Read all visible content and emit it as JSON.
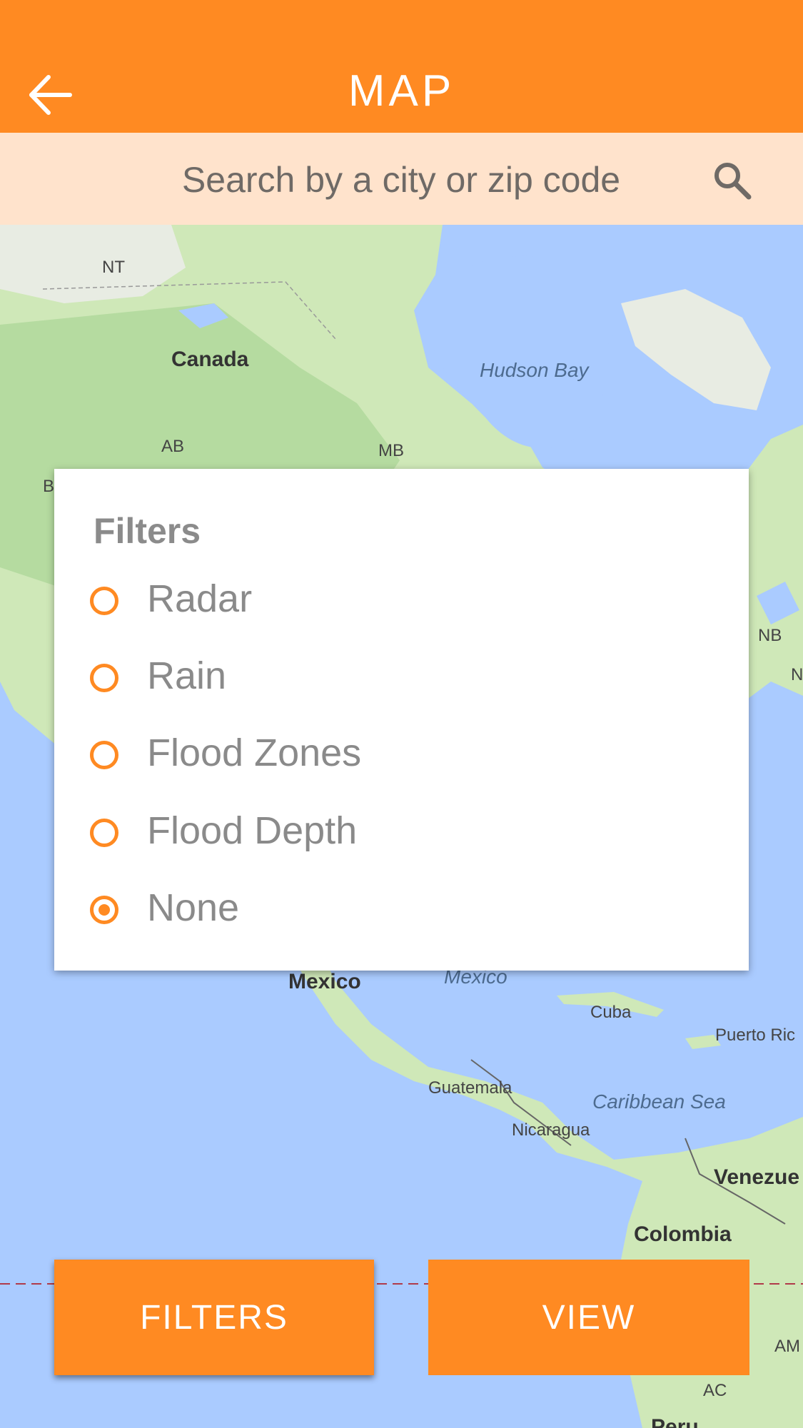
{
  "header": {
    "title": "MAP",
    "back_icon": "arrow-left-icon"
  },
  "search": {
    "placeholder": "Search by a city or zip code",
    "icon": "search-icon"
  },
  "map": {
    "labels": {
      "nt": "NT",
      "canada": "Canada",
      "hudson_bay": "Hudson Bay",
      "ab": "AB",
      "mb": "MB",
      "bc": "B",
      "nb": "NB",
      "ns": "N",
      "mexico": "Mexico",
      "gulf": "Mexico",
      "cuba": "Cuba",
      "puerto_rico": "Puerto Ric",
      "guatemala": "Guatemala",
      "caribbean": "Caribbean Sea",
      "nicaragua": "Nicaragua",
      "venezuela": "Venezue",
      "colombia": "Colombia",
      "am": "AM",
      "ac": "AC",
      "peru": "Peru"
    }
  },
  "filters_dialog": {
    "title": "Filters",
    "options": [
      {
        "label": "Radar",
        "checked": false
      },
      {
        "label": "Rain",
        "checked": false
      },
      {
        "label": "Flood Zones",
        "checked": false
      },
      {
        "label": "Flood Depth",
        "checked": false
      },
      {
        "label": "None",
        "checked": true
      }
    ]
  },
  "buttons": {
    "filters": "FILTERS",
    "view": "VIEW"
  },
  "colors": {
    "accent": "#ff8a22",
    "search_bg": "#ffe3cc",
    "water": "#aacbff",
    "land": "#cfe8b8"
  }
}
